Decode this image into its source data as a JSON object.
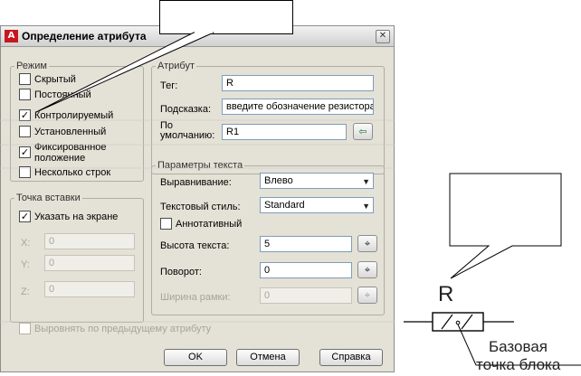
{
  "window": {
    "title": "Определение атрибута",
    "app_icon": "autocad-a-icon",
    "close_glyph": "✕"
  },
  "mode": {
    "legend": "Режим",
    "items": [
      {
        "label": "Скрытый",
        "checked": false
      },
      {
        "label": "Постоянный",
        "checked": false
      },
      {
        "label": "Контролируемый",
        "checked": true
      },
      {
        "label": "Установленный",
        "checked": false
      },
      {
        "label": "Фиксированное положение",
        "checked": true
      },
      {
        "label": "Несколько строк",
        "checked": false
      }
    ]
  },
  "attribute": {
    "legend": "Атрибут",
    "tag_label": "Тег:",
    "tag_value": "R",
    "prompt_label": "Подсказка:",
    "prompt_value": "введите обозначение резистора",
    "default_label": "По умолчанию:",
    "default_value": "R1"
  },
  "insertion": {
    "legend": "Точка вставки",
    "specify_label": "Указать на экране",
    "specify_checked": true,
    "x_label": "X:",
    "x_value": "0",
    "y_label": "Y:",
    "y_value": "0",
    "z_label": "Z:",
    "z_value": "0"
  },
  "text_params": {
    "legend": "Параметры текста",
    "justify_label": "Выравнивание:",
    "justify_value": "Влево",
    "style_label": "Текстовый стиль:",
    "style_value": "Standard",
    "annotative_label": "Аннотативный",
    "annotative_checked": false,
    "height_label": "Высота текста:",
    "height_value": "5",
    "rotation_label": "Поворот:",
    "rotation_value": "0",
    "width_label": "Ширина рамки:",
    "width_value": "0"
  },
  "align_prev": {
    "label": "Выровнять по предыдущему атрибуту",
    "checked": false
  },
  "buttons": {
    "ok": "OK",
    "cancel": "Отмена",
    "help": "Справка"
  },
  "drawing": {
    "attr_letter": "R",
    "caption_line1": "Базовая",
    "caption_line2": "точка блока"
  },
  "colors": {
    "title_text": "#000000",
    "app_icon_bg": "#c8161d",
    "dialog_bg": "#e4e1d6"
  }
}
